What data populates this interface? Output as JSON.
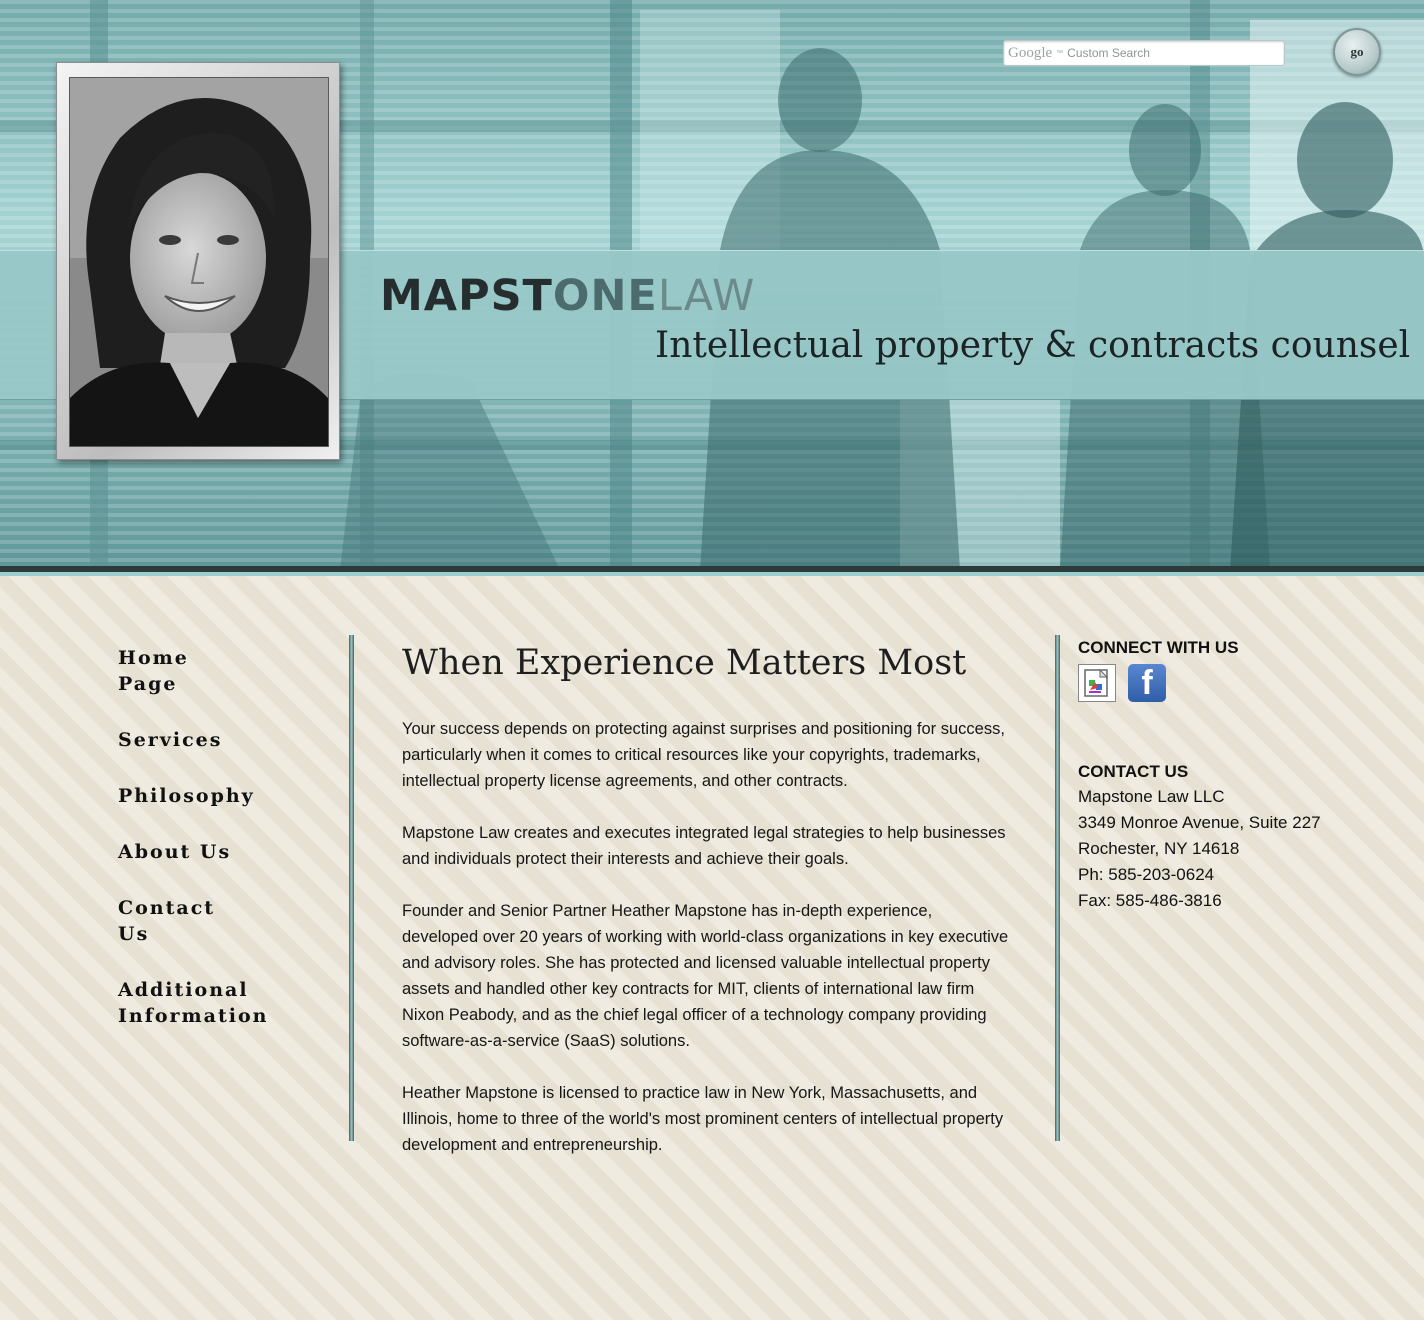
{
  "search": {
    "brand": "Google",
    "brand_tm": "™",
    "placeholder": "Custom Search",
    "button_label": "go"
  },
  "header": {
    "logo_part1": "MAPST",
    "logo_part2": "ONE",
    "logo_part3": "LAW",
    "tagline": "Intellectual property & contracts counsel"
  },
  "nav": {
    "items": [
      {
        "line1": "Home",
        "line2": "Page"
      },
      {
        "line1": "Services",
        "line2": ""
      },
      {
        "line1": "Philosophy",
        "line2": ""
      },
      {
        "line1": "About Us",
        "line2": ""
      },
      {
        "line1": "Contact",
        "line2": "Us"
      },
      {
        "line1": "Additional",
        "line2": "Information"
      }
    ]
  },
  "main": {
    "title": "When Experience Matters Most",
    "paragraphs": [
      "Your success depends on protecting against surprises and positioning for success, particularly when it comes to critical resources like your copyrights, trademarks, intellectual property license agreements, and other contracts.",
      "Mapstone Law creates and executes integrated legal strategies to help businesses and individuals protect their interests and achieve their goals.",
      "Founder and Senior Partner Heather Mapstone has in-depth experience, developed over 20 years of working with world-class organizations in key executive and advisory roles. She has protected and licensed valuable intellectual property assets and handled other key contracts for MIT, clients of international law firm Nixon Peabody, and as the chief legal officer of a technology company providing software-as-a-service (SaaS) solutions.",
      "Heather Mapstone is licensed to practice law in New York, Massachusetts, and Illinois, home to three of the world's most prominent centers of intellectual property development and entrepreneurship."
    ]
  },
  "sidebar": {
    "connect_heading": "CONNECT WITH US",
    "facebook_glyph": "f",
    "contact_heading": "CONTACT US",
    "contact_lines": [
      "Mapstone Law LLC",
      "3349 Monroe Avenue, Suite 227",
      "Rochester, NY 14618",
      "Ph: 585-203-0624",
      "Fax: 585-486-3816"
    ]
  },
  "colors": {
    "band": "#98c9c8",
    "background": "#efebe0",
    "facebook": "#3b5998"
  }
}
